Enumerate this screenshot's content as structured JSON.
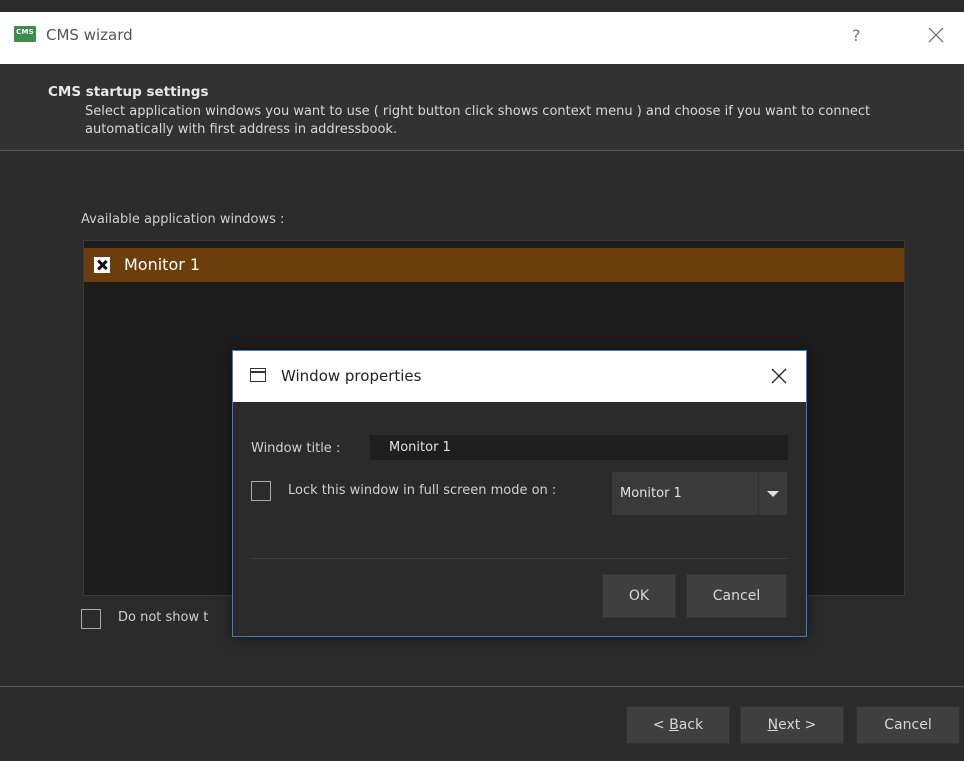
{
  "window": {
    "title": "CMS wizard",
    "app_icon_text": "CMS",
    "help_label": "?"
  },
  "header": {
    "title": "CMS startup settings",
    "description": "Select application windows you want to use ( right button click shows context menu ) and choose if you want to connect automatically with first address in addressbook."
  },
  "body": {
    "available_label": "Available application windows :",
    "items": [
      {
        "label": "Monitor 1",
        "checked": true
      }
    ],
    "dont_show_label": "Do not show t"
  },
  "footer": {
    "back_label": "< Back",
    "back_prefix": "< ",
    "back_mnemonic": "B",
    "back_rest": "ack",
    "next_mnemonic": "N",
    "next_rest": "ext >",
    "cancel_label": "Cancel"
  },
  "dialog": {
    "title": "Window properties",
    "window_title_label": "Window title :",
    "window_title_value": "Monitor 1",
    "lock_label": "Lock this window in full screen mode on :",
    "lock_checked": false,
    "monitor_selected": "Monitor 1",
    "ok_label": "OK",
    "cancel_label": "Cancel"
  },
  "colors": {
    "selected_row": "#6b3e0b",
    "dialog_border": "#3d7bd0",
    "app_icon": "#3d8b4f"
  }
}
